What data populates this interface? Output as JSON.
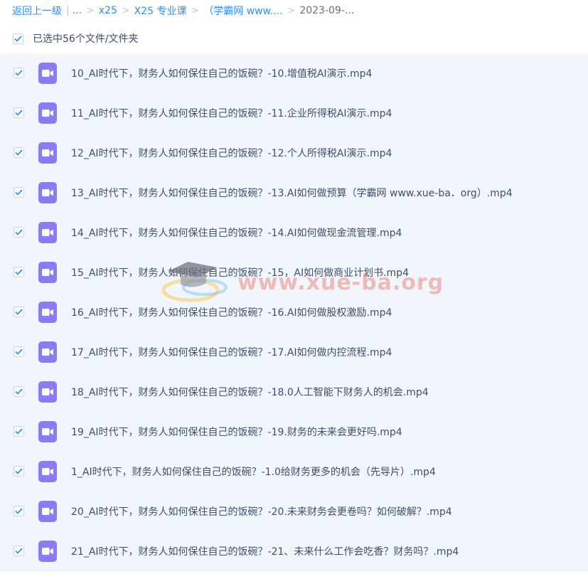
{
  "breadcrumb": {
    "back_label": "返回上一级",
    "divider": "|",
    "ellipsis": "...",
    "separator": ">",
    "items": [
      "x25",
      "X25 专业课",
      "（学霸网 www....",
      "2023-09-..."
    ]
  },
  "selection": {
    "summary": "已选中56个文件/文件夹",
    "checked": true
  },
  "files": [
    {
      "name": "10_AI时代下，财务人如何保住自己的饭碗？-10.增值税AI演示.mp4",
      "checked": true,
      "icon": "video-file-icon"
    },
    {
      "name": "11_AI时代下，财务人如何保住自己的饭碗？-11.企业所得税AI演示.mp4",
      "checked": true,
      "icon": "video-file-icon"
    },
    {
      "name": "12_AI时代下，财务人如何保住自己的饭碗？-12.个人所得税AI演示.mp4",
      "checked": true,
      "icon": "video-file-icon"
    },
    {
      "name": "13_AI时代下，财务人如何保住自己的饭碗？-13.AI如何做预算（学霸网 www.xue-ba．org）.mp4",
      "checked": true,
      "icon": "video-file-icon"
    },
    {
      "name": "14_AI时代下，财务人如何保住自己的饭碗？-14.AI如何做现金流管理.mp4",
      "checked": true,
      "icon": "video-file-icon"
    },
    {
      "name": "15_AI时代下，财务人如何保住自己的饭碗？-15，AI如何做商业计划书.mp4",
      "checked": true,
      "icon": "video-file-icon"
    },
    {
      "name": "16_AI时代下，财务人如何保住自己的饭碗？-16.AI如何做股权激励.mp4",
      "checked": true,
      "icon": "video-file-icon"
    },
    {
      "name": "17_AI时代下，财务人如何保住自己的饭碗？-17.AI如何做内控流程.mp4",
      "checked": true,
      "icon": "video-file-icon"
    },
    {
      "name": "18_AI时代下，财务人如何保住自己的饭碗？-18.0人工智能下财务人的机会.mp4",
      "checked": true,
      "icon": "video-file-icon"
    },
    {
      "name": "19_AI时代下，财务人如何保住自己的饭碗？-19.财务的未来会更好吗.mp4",
      "checked": true,
      "icon": "video-file-icon"
    },
    {
      "name": "1_AI时代下，财务人如何保住自己的饭碗？-1.0给财务更多的机会（先导片）.mp4",
      "checked": true,
      "icon": "video-file-icon"
    },
    {
      "name": "20_AI时代下，财务人如何保住自己的饭碗？-20.未来财务会更卷吗？如何破解？.mp4",
      "checked": true,
      "icon": "video-file-icon"
    },
    {
      "name": "21_AI时代下，财务人如何保住自己的饭碗？-21、未来什么工作会吃香？财务吗？.mp4",
      "checked": true,
      "icon": "video-file-icon"
    }
  ],
  "watermark": {
    "text": "www.xue-ba.org"
  },
  "colors": {
    "accent": "#2e8ff1",
    "row_background": "#f1f6fd",
    "video_icon": "#8b7cf5",
    "text": "#424e67"
  }
}
